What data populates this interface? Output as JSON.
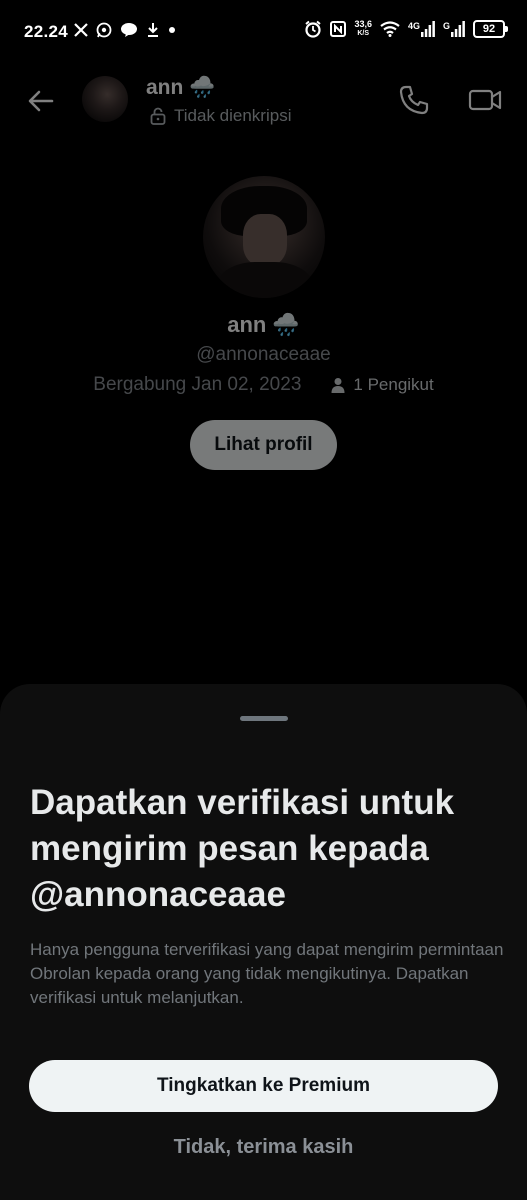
{
  "status_bar": {
    "time": "22.24",
    "net_speed_value": "33,6",
    "net_speed_unit": "K/S",
    "network_1": "4G",
    "network_2": "G",
    "battery": "92",
    "notification_icons": [
      "x-icon",
      "whatsapp-icon",
      "line-icon",
      "download-icon",
      "dot-icon"
    ],
    "system_icons": [
      "alarm-icon",
      "nfc-icon",
      "wifi-icon",
      "signal-icon",
      "signal-icon"
    ]
  },
  "header": {
    "name": "ann",
    "emoji": "🌧️",
    "encryption_status": "Tidak dienkripsi",
    "icons": [
      "back-arrow-icon",
      "lock-icon",
      "phone-icon",
      "video-icon"
    ]
  },
  "profile": {
    "name": "ann",
    "emoji": "🌧️",
    "handle": "@annonaceaae",
    "joined": "Bergabung Jan 02, 2023",
    "followers": "1 Pengikut",
    "view_profile_label": "Lihat profil"
  },
  "sheet": {
    "title": "Dapatkan verifikasi untuk mengirim pesan kepada @annonaceaae",
    "body": "Hanya pengguna terverifikasi yang dapat mengirim permintaan Obrolan kepada orang yang tidak mengikutinya. Dapatkan verifikasi untuk melanjutkan.",
    "primary_button": "Tingkatkan ke Premium",
    "secondary_button": "Tidak, terima kasih"
  },
  "colors": {
    "background": "#000000",
    "sheet": "#0e0e0e",
    "button": "#eff3f4",
    "muted_text": "#71767b"
  }
}
